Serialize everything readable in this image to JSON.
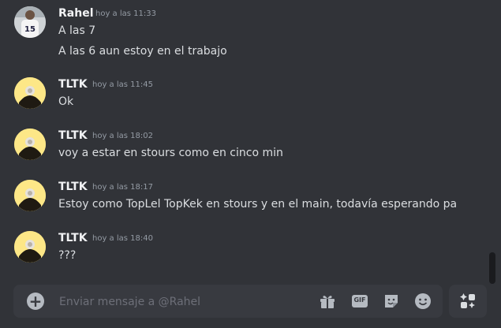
{
  "messages": [
    {
      "author": "Rahel",
      "timestamp": "hoy a las 11:33",
      "avatar_icon": "user-photo-avatar",
      "lines": [
        "A las 7",
        "A las 6 aun estoy en el trabajo"
      ]
    },
    {
      "author": "TLTK",
      "timestamp": "hoy a las 11:45",
      "avatar_icon": "hooded-figure-avatar",
      "lines": [
        "Ok"
      ]
    },
    {
      "author": "TLTK",
      "timestamp": "hoy a las 18:02",
      "avatar_icon": "hooded-figure-avatar",
      "lines": [
        "voy a estar en stours como en cinco min"
      ]
    },
    {
      "author": "TLTK",
      "timestamp": "hoy a las 18:17",
      "avatar_icon": "hooded-figure-avatar",
      "lines": [
        "Estoy como TopLel TopKek en stours y en el main, todavía esperando pa"
      ]
    },
    {
      "author": "TLTK",
      "timestamp": "hoy a las 18:40",
      "avatar_icon": "hooded-figure-avatar",
      "lines": [
        "???"
      ]
    }
  ],
  "composer": {
    "placeholder": "Enviar mensaje a @Rahel",
    "value": "",
    "gif_label": "GIF"
  },
  "colors": {
    "background": "#313338",
    "composer": "#383a40",
    "avatar_yellow": "#fde787"
  }
}
